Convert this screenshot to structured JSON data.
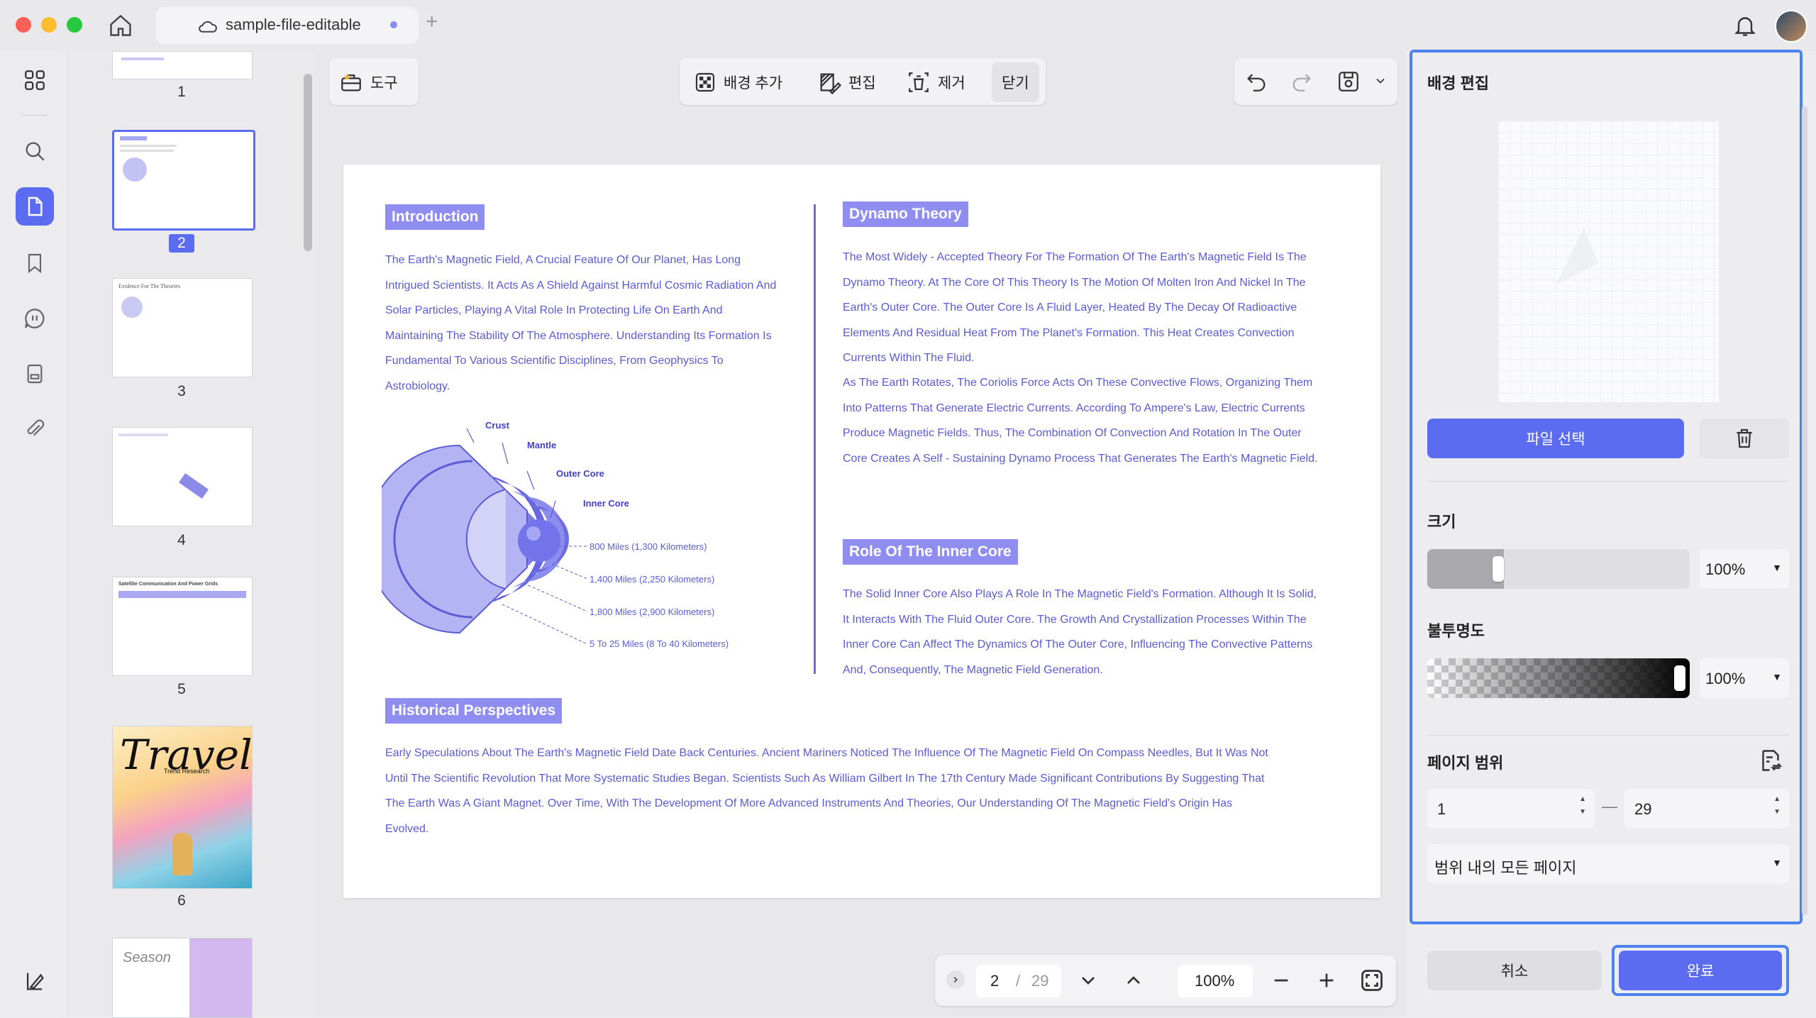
{
  "window": {
    "tab_title": "sample-file-editable"
  },
  "rail": {
    "icons": [
      "grid-icon",
      "search-icon",
      "page-icon",
      "bookmark-icon",
      "comment-icon",
      "form-icon",
      "attachment-icon",
      "layers-icon"
    ]
  },
  "thumbnails": {
    "pages": [
      {
        "num": "1"
      },
      {
        "num": "2"
      },
      {
        "num": "3"
      },
      {
        "num": "4"
      },
      {
        "num": "5"
      },
      {
        "num": "6"
      }
    ],
    "thumb3_title": "Evidence For The Theories",
    "thumb5_title": "Satellite Communication And Power Grids",
    "thumb6_script": "Travel",
    "thumb6_sub": "Trend Research",
    "thumb7_script": "Season"
  },
  "toolbar": {
    "tool_label": "도구",
    "add_bg_label": "배경 추가",
    "edit_label": "편집",
    "remove_label": "제거",
    "close_label": "닫기"
  },
  "document": {
    "intro_heading": "Introduction",
    "intro_text": "The Earth's Magnetic Field, A Crucial Feature Of Our Planet, Has Long Intrigued Scientists. It Acts As A Shield Against Harmful Cosmic Radiation And Solar Particles, Playing A Vital Role In Protecting Life On Earth And Maintaining The Stability Of The Atmosphere. Understanding Its Formation Is Fundamental To Various Scientific Disciplines, From Geophysics To Astrobiology.",
    "diagram": {
      "crust": "Crust",
      "mantle": "Mantle",
      "outer_core": "Outer Core",
      "inner_core": "Inner Core",
      "d1": "800 Miles (1,300 Kilometers)",
      "d2": "1,400 Miles (2,250 Kilometers)",
      "d3": "1,800 Miles (2,900 Kilometers)",
      "d4": "5 To 25 Miles (8 To 40 Kilometers)"
    },
    "dynamo_heading": "Dynamo Theory",
    "dynamo_text": "The Most Widely - Accepted Theory For The Formation Of The Earth's Magnetic Field Is The Dynamo Theory. At The Core Of This Theory Is The Motion Of Molten Iron And Nickel In The Earth's Outer Core. The Outer Core Is A Fluid Layer, Heated By The Decay Of Radioactive Elements And Residual Heat From The Planet's Formation. This Heat Creates Convection Currents Within The Fluid.",
    "dynamo_text2": "As The Earth Rotates, The Coriolis Force Acts On These Convective Flows, Organizing Them Into Patterns That Generate Electric Currents. According To Ampere's Law, Electric Currents Produce Magnetic Fields. Thus, The Combination Of Convection And Rotation In The Outer Core Creates A Self - Sustaining Dynamo Process That Generates The Earth's Magnetic Field.",
    "inner_heading": "Role Of The Inner Core",
    "inner_text": "The Solid Inner Core Also Plays A Role In The Magnetic Field's Formation. Although It Is Solid, It Interacts With The Fluid Outer Core. The Growth And Crystallization Processes Within The Inner Core Can Affect The Dynamics Of The Outer Core, Influencing The Convective Patterns And, Consequently, The Magnetic Field Generation.",
    "hist_heading": "Historical Perspectives",
    "hist_text": "Early Speculations About The Earth's Magnetic Field Date Back Centuries. Ancient Mariners Noticed The Influence Of The Magnetic Field On Compass Needles, But It Was Not Until The Scientific Revolution That More Systematic Studies Began. Scientists Such As William Gilbert In The 17th Century Made Significant Contributions By Suggesting That The Earth Was A Giant Magnet. Over Time, With The Development Of More Advanced Instruments And Theories, Our Understanding Of The Magnetic Field's Origin Has Evolved."
  },
  "pager": {
    "current": "2",
    "sep": "/",
    "total": "29",
    "zoom": "100%"
  },
  "panel": {
    "title": "배경 편집",
    "choose_file": "파일 선택",
    "size_label": "크기",
    "size_value": "100%",
    "size_level": 0.25,
    "opacity_label": "불투명도",
    "opacity_value": "100%",
    "opacity_level": 1.0,
    "range_label": "페이지 범위",
    "range_from": "1",
    "range_dash": "—",
    "range_to": "29",
    "range_mode": "범위 내의 모든 페이지",
    "cancel": "취소",
    "done": "완료"
  },
  "colors": {
    "accent": "#5b6cf0",
    "doc_text": "#5b5bd6",
    "heading_bg": "#8f8ef0"
  }
}
